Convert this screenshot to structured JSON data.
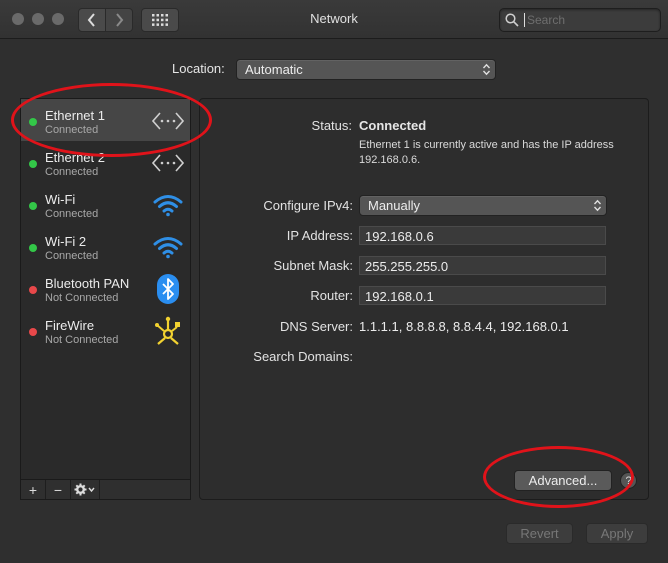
{
  "window": {
    "title": "Network"
  },
  "search": {
    "placeholder": "Search"
  },
  "location": {
    "label": "Location:",
    "value": "Automatic"
  },
  "services": [
    {
      "name": "Ethernet 1",
      "status": "Connected",
      "dot_color": "#33c748",
      "icon": "ethernet-icon",
      "selected": true
    },
    {
      "name": "Ethernet 2",
      "status": "Connected",
      "dot_color": "#33c748",
      "icon": "ethernet-icon",
      "selected": false
    },
    {
      "name": "Wi-Fi",
      "status": "Connected",
      "dot_color": "#33c748",
      "icon": "wifi-icon",
      "selected": false
    },
    {
      "name": "Wi-Fi 2",
      "status": "Connected",
      "dot_color": "#33c748",
      "icon": "wifi-icon",
      "selected": false
    },
    {
      "name": "Bluetooth PAN",
      "status": "Not Connected",
      "dot_color": "#e8484a",
      "icon": "bluetooth-icon",
      "selected": false
    },
    {
      "name": "FireWire",
      "status": "Not Connected",
      "dot_color": "#e8484a",
      "icon": "firewire-icon",
      "selected": false
    }
  ],
  "sidebar_toolbar": {
    "add": "+",
    "remove": "−"
  },
  "detail": {
    "status_label": "Status:",
    "status_value": "Connected",
    "status_desc": "Ethernet 1 is currently active and has the IP address 192.168.0.6.",
    "configure_label": "Configure IPv4:",
    "configure_value": "Manually",
    "ip_label": "IP Address:",
    "ip_value": "192.168.0.6",
    "subnet_label": "Subnet Mask:",
    "subnet_value": "255.255.255.0",
    "router_label": "Router:",
    "router_value": "192.168.0.1",
    "dns_label": "DNS Server:",
    "dns_value": "1.1.1.1, 8.8.8.8, 8.8.4.4, 192.168.0.1",
    "search_domains_label": "Search Domains:",
    "advanced_label": "Advanced...",
    "help_label": "?"
  },
  "footer": {
    "revert_label": "Revert",
    "apply_label": "Apply"
  },
  "colors": {
    "annotation": "#e0131a",
    "wifi": "#2f8fe6",
    "bluetooth": "#2a8ef0",
    "firewire": "#f2d230"
  }
}
